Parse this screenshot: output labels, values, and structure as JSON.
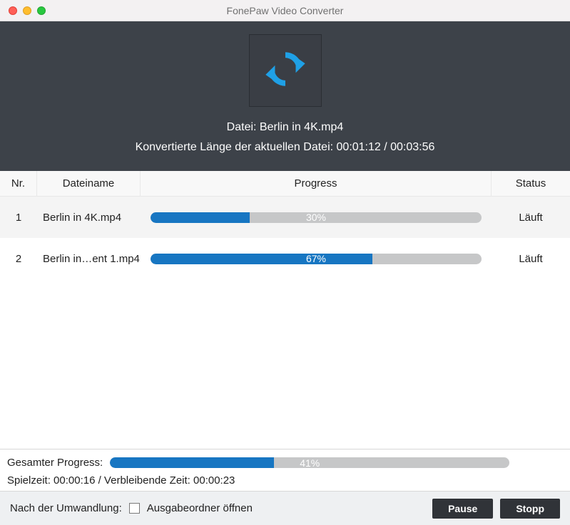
{
  "titlebar": {
    "title": "FonePaw Video Converter"
  },
  "hero": {
    "file_label": "Datei: Berlin in 4K.mp4",
    "length_label": "Konvertierte Länge der aktuellen Datei: 00:01:12 / 00:03:56"
  },
  "columns": {
    "nr": "Nr.",
    "name": "Dateiname",
    "progress": "Progress",
    "status": "Status"
  },
  "rows": [
    {
      "nr": "1",
      "name": "Berlin in 4K.mp4",
      "percent": 30,
      "percent_label": "30%",
      "status": "Läuft"
    },
    {
      "nr": "2",
      "name": "Berlin in…ent 1.mp4",
      "percent": 67,
      "percent_label": "67%",
      "status": "Läuft"
    }
  ],
  "summary": {
    "total_label": "Gesamter Progress:",
    "total_percent": 41,
    "total_percent_label": "41%",
    "time_line": "Spielzeit: 00:00:16 / Verbleibende Zeit: 00:00:23"
  },
  "footer": {
    "after_label": "Nach der Umwandlung:",
    "open_folder_label": "Ausgabeordner öffnen",
    "pause": "Pause",
    "stop": "Stopp"
  }
}
